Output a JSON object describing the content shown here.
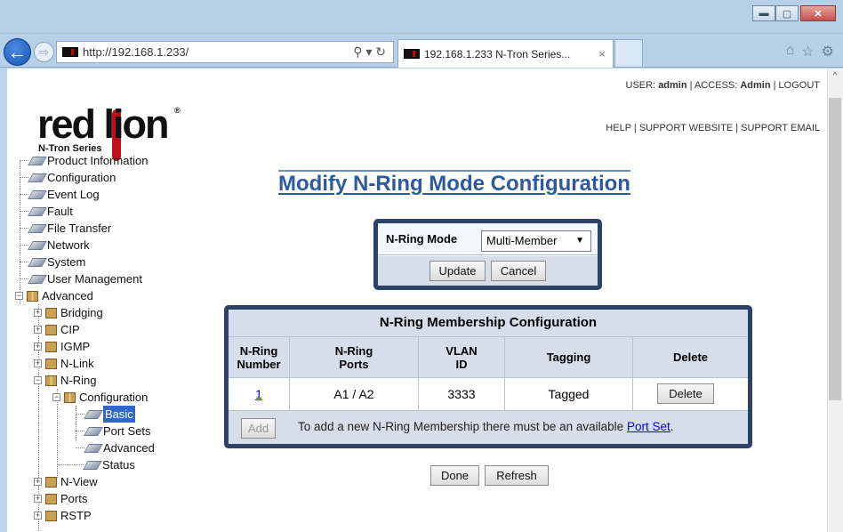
{
  "browser": {
    "address_url": "http://192.168.1.233/",
    "tab_title": "192.168.1.233 N-Tron Series...",
    "tab_close": "×",
    "window_buttons": {
      "minimize": "▬",
      "maximize": "▢",
      "close": "✕"
    },
    "address_tools": "⚲ ▾ ↻",
    "right_icons": [
      "home-icon",
      "star-icon",
      "gear-icon"
    ],
    "right_icon_glyphs": [
      "⌂",
      "☆",
      "⚙"
    ]
  },
  "logo": {
    "brand": "red lion",
    "subtitle": "N-Tron Series",
    "reg": "®"
  },
  "header_links": {
    "user_label": "USER:",
    "user": "admin",
    "access_label": "ACCESS:",
    "access": "Admin",
    "logout": "LOGOUT",
    "help": "HELP",
    "support_website": "SUPPORT WEBSITE",
    "support_email": "SUPPORT EMAIL",
    "sep": "|"
  },
  "tree": {
    "product_information": "Product Information",
    "configuration": "Configuration",
    "event_log": "Event Log",
    "fault": "Fault",
    "file_transfer": "File Transfer",
    "network": "Network",
    "system": "System",
    "user_management": "User Management",
    "advanced": "Advanced",
    "bridging": "Bridging",
    "cip": "CIP",
    "igmp": "IGMP",
    "n_link": "N-Link",
    "n_ring": "N-Ring",
    "nring_configuration": "Configuration",
    "basic": "Basic",
    "port_sets": "Port Sets",
    "adv": "Advanced",
    "status": "Status",
    "n_view": "N-View",
    "ports": "Ports",
    "rstp": "RSTP",
    "plus": "+",
    "minus": "−"
  },
  "main": {
    "title": "Modify N-Ring Mode Configuration",
    "mode_label": "N-Ring Mode",
    "mode_value": "Multi-Member",
    "mode_arrow": "▼",
    "update": "Update",
    "cancel": "Cancel",
    "table_title": "N-Ring Membership Configuration",
    "headers": {
      "number1": "N-Ring",
      "number2": "Number",
      "ports1": "N-Ring",
      "ports2": "Ports",
      "vlan1": "VLAN",
      "vlan2": "ID",
      "tagging": "Tagging",
      "delete": "Delete"
    },
    "row": {
      "number": "1",
      "ports": "A1 / A2",
      "vlan": "3333",
      "tagging": "Tagged",
      "delete_btn": "Delete"
    },
    "add_btn": "Add",
    "add_text": "To add a new N-Ring Membership there must be an available",
    "port_set_link": "Port Set",
    "add_end": ".",
    "done": "Done",
    "refresh": "Refresh"
  }
}
